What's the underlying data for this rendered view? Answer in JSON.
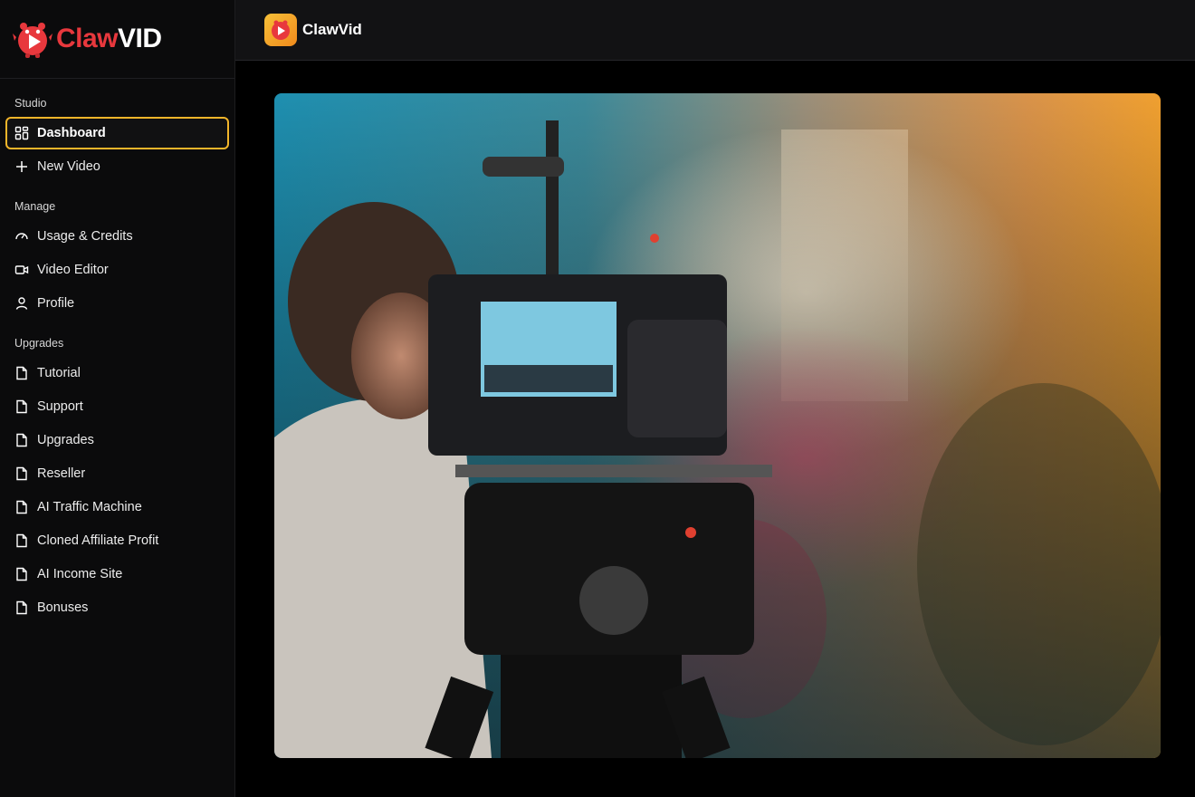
{
  "brand": {
    "name_part1": "Claw",
    "name_part2": "VID"
  },
  "topbar": {
    "title": "ClawVid"
  },
  "sidebar": {
    "sections": [
      {
        "label": "Studio",
        "items": [
          {
            "label": "Dashboard",
            "icon": "grid-icon",
            "active": true
          },
          {
            "label": "New Video",
            "icon": "plus-icon"
          }
        ]
      },
      {
        "label": "Manage",
        "items": [
          {
            "label": "Usage & Credits",
            "icon": "gauge-icon"
          },
          {
            "label": "Video Editor",
            "icon": "video-camera-icon"
          },
          {
            "label": "Profile",
            "icon": "user-icon"
          }
        ]
      },
      {
        "label": "Upgrades",
        "items": [
          {
            "label": "Tutorial",
            "icon": "document-icon"
          },
          {
            "label": "Support",
            "icon": "document-icon"
          },
          {
            "label": "Upgrades",
            "icon": "document-icon"
          },
          {
            "label": "Reseller",
            "icon": "document-icon"
          },
          {
            "label": "AI Traffic Machine",
            "icon": "document-icon"
          },
          {
            "label": "Cloned Affiliate Profit",
            "icon": "document-icon"
          },
          {
            "label": "AI Income Site",
            "icon": "document-icon"
          },
          {
            "label": "Bonuses",
            "icon": "document-icon"
          }
        ]
      }
    ]
  },
  "colors": {
    "accent": "#f2b52a",
    "brand_red": "#e8383d",
    "sidebar_bg": "#0b0b0c",
    "topbar_bg": "#121214"
  }
}
